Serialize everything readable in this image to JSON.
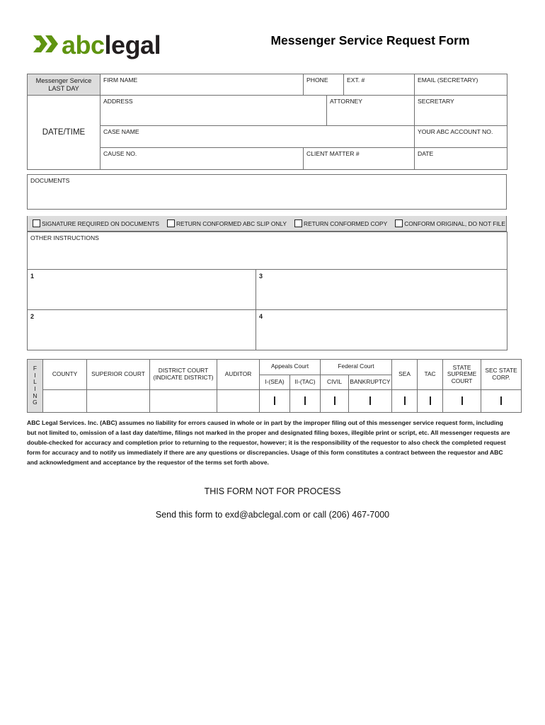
{
  "header": {
    "logo_abc": "abc",
    "logo_legal": "legal",
    "logo_mark_name": "abc-legal-chevron-logo",
    "title": "Messenger Service Request Form"
  },
  "top_table": {
    "messenger_service_line1": "Messenger Service",
    "messenger_service_line2": "LAST DAY",
    "date_time": "DATE/TIME",
    "firm_name": "FIRM NAME",
    "phone": "PHONE",
    "ext": "EXT. #",
    "email_secretary": "EMAIL (SECRETARY)",
    "address": "ADDRESS",
    "attorney": "ATTORNEY",
    "secretary": "SECRETARY",
    "case_name": "CASE NAME",
    "your_abc_account_no": "YOUR ABC ACCOUNT NO.",
    "cause_no": "CAUSE NO.",
    "client_matter": "CLIENT MATTER #",
    "date": "DATE"
  },
  "documents": {
    "label": "DOCUMENTS"
  },
  "checkbox_options": [
    {
      "label": "SIGNATURE REQUIRED ON DOCUMENTS",
      "checked": false
    },
    {
      "label": "RETURN CONFORMED ABC SLIP ONLY",
      "checked": false
    },
    {
      "label": "RETURN CONFORMED COPY",
      "checked": false
    },
    {
      "label": "CONFORM ORIGINAL, DO NOT FILE",
      "checked": false
    }
  ],
  "instructions": {
    "label": "OTHER INSTRUCTIONS",
    "boxes": [
      "1",
      "2",
      "3",
      "4"
    ]
  },
  "filing_table": {
    "vertical_label": "FILING",
    "vertical_letters": [
      "F",
      "I",
      "L",
      "I",
      "N",
      "G"
    ],
    "columns": [
      {
        "name": "county",
        "label": "COUNTY",
        "type": "text"
      },
      {
        "name": "superior-court",
        "label": "SUPERIOR COURT",
        "type": "text"
      },
      {
        "name": "district-court",
        "label": "DISTRICT COURT",
        "label2": "(INDICATE DISTRICT)",
        "type": "text"
      },
      {
        "name": "auditor",
        "label": "AUDITOR",
        "type": "text"
      }
    ],
    "groups": [
      {
        "name": "appeals-court",
        "label": "Appeals Court",
        "subs": [
          {
            "name": "appeals-i-sea",
            "label": "I-(SEA)",
            "checked": false
          },
          {
            "name": "appeals-ii-tac",
            "label": "II-(TAC)",
            "checked": false
          }
        ]
      },
      {
        "name": "federal-court",
        "label": "Federal Court",
        "subs": [
          {
            "name": "federal-civil",
            "label": "CIVIL",
            "checked": false
          },
          {
            "name": "federal-bankruptcy",
            "label": "BANKRUPTCY",
            "checked": false
          }
        ]
      }
    ],
    "checkbox_columns": [
      {
        "name": "sea",
        "label": "SEA",
        "checked": false
      },
      {
        "name": "tac",
        "label": "TAC",
        "checked": false
      },
      {
        "name": "state-supreme-court",
        "label": "STATE SUPREME COURT",
        "checked": false
      },
      {
        "name": "sec-state-corp",
        "label": "SEC STATE CORP.",
        "checked": false
      }
    ]
  },
  "disclaimer": "ABC Legal Services. Inc. (ABC) assumes no liability for errors caused in whole or in part by the improper filing out of this messenger service request form, including but not limited to, omission of a last day date/time, filings not marked in the proper and designated filing boxes, illegible print or script, etc. All messenger requests are double-checked for accuracy and completion prior to returning to the requestor, however; it is the responsibility of the requestor to also check the completed request form for accuracy and to notify us immediately if there are any questions or discrepancies. Usage of this form constitutes a contract between the requestor and ABC and acknowledgment and acceptance by the requestor of the terms set forth above.",
  "footer": {
    "main": "THIS FORM NOT FOR PROCESS",
    "sub": "Send this form to exd@abclegal.com or call (206) 467-7000"
  },
  "colors": {
    "brand_green": "#5f9410",
    "brand_dark": "#231f20",
    "header_gray": "#dddddd",
    "border_gray": "#6f6f6f"
  }
}
